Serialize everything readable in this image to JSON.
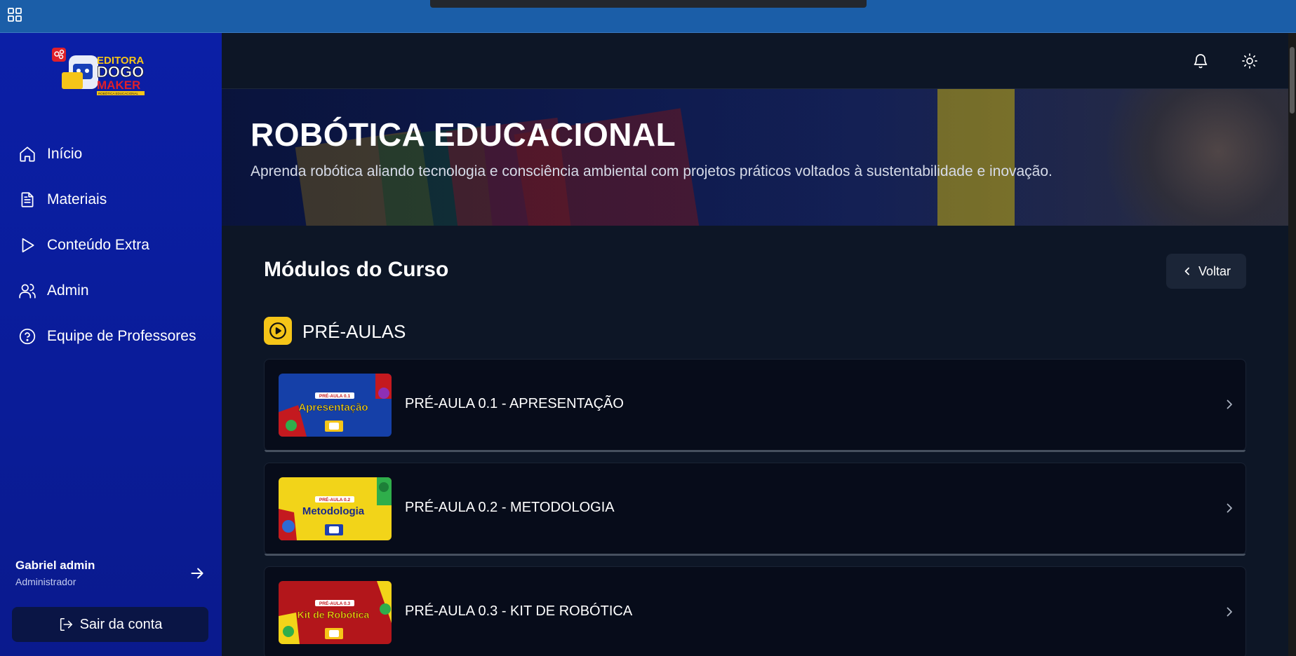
{
  "os": {
    "apps_icon": "grid-icon"
  },
  "sidebar": {
    "logo": {
      "line1": "EDITORA",
      "line2": "DOGO",
      "line3": "MAKER",
      "tagline": "ROBÓTICA EDUCACIONAL"
    },
    "items": [
      {
        "label": "Início",
        "icon": "home-icon"
      },
      {
        "label": "Materiais",
        "icon": "document-icon"
      },
      {
        "label": "Conteúdo Extra",
        "icon": "play-icon"
      },
      {
        "label": "Admin",
        "icon": "users-icon"
      },
      {
        "label": "Equipe de Professores",
        "icon": "help-circle-icon"
      }
    ],
    "user": {
      "name": "Gabriel admin",
      "role": "Administrador"
    },
    "logout_label": "Sair da conta"
  },
  "header": {
    "icons": [
      "bell-icon",
      "sun-icon"
    ]
  },
  "hero": {
    "title": "ROBÓTICA EDUCACIONAL",
    "subtitle": "Aprenda robótica aliando tecnologia e consciência ambiental com projetos práticos voltados à sustentabilidade e inovação."
  },
  "main": {
    "section_title": "Módulos do Curso",
    "back_label": "Voltar",
    "module": {
      "name": "PRÉ-AULAS",
      "lessons": [
        {
          "title": "PRÉ-AULA 0.1 - APRESENTAÇÃO",
          "thumb_tag": "PRÉ-AULA 0.1",
          "thumb_text": "Apresentação",
          "thumb_bg": "#1540a8",
          "thumb_text_color": "#f5d20f"
        },
        {
          "title": "PRÉ-AULA 0.2 - METODOLOGIA",
          "thumb_tag": "PRÉ-AULA 0.2",
          "thumb_text": "Metodologia",
          "thumb_bg": "#f2d419",
          "thumb_text_color": "#1a2a8a"
        },
        {
          "title": "PRÉ-AULA 0.3 - KIT DE ROBÓTICA",
          "thumb_tag": "PRÉ-AULA 0.3",
          "thumb_text": "Kit de Robótica",
          "thumb_bg": "#b3161b",
          "thumb_text_color": "#f5d20f"
        }
      ]
    }
  },
  "colors": {
    "sidebar": "#0b1fa6",
    "accent": "#f5c518",
    "page": "#0d1626",
    "os_bar": "#1b5ea8"
  }
}
